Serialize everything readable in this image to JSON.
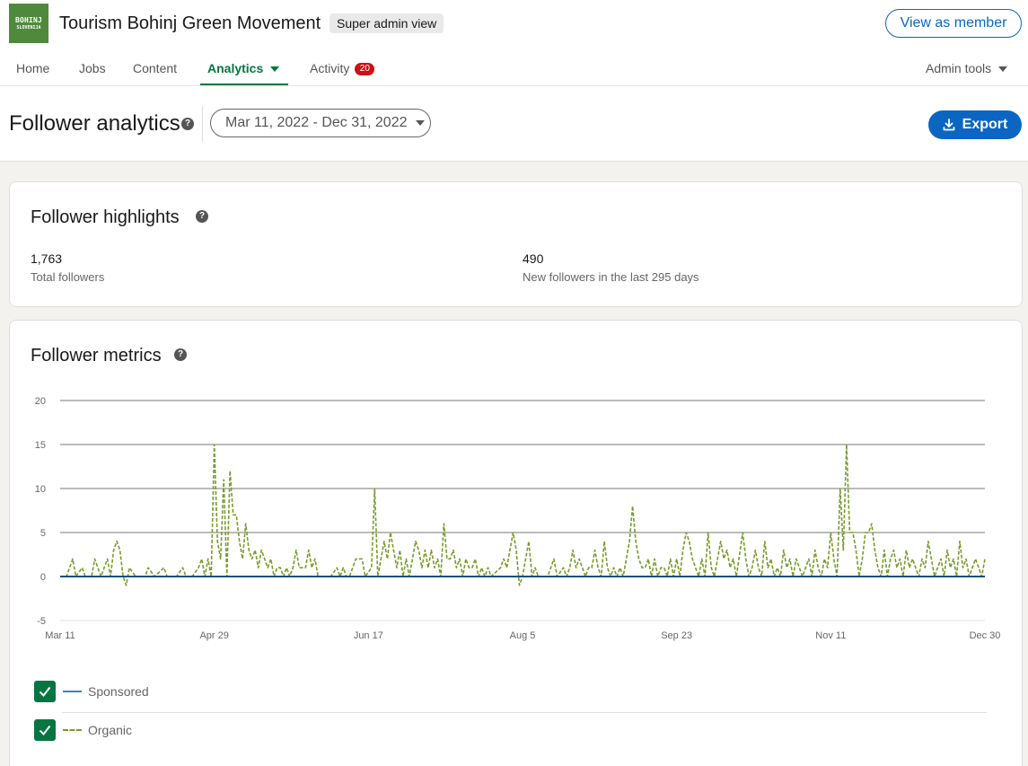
{
  "org": {
    "logo_text": [
      "BOHINJ",
      "SLOVENIJA"
    ],
    "name": "Tourism Bohinj Green Movement",
    "admin_badge": "Super admin view",
    "view_as_member": "View as member"
  },
  "nav": {
    "home": "Home",
    "jobs": "Jobs",
    "content": "Content",
    "analytics": "Analytics",
    "activity": "Activity",
    "activity_count": "20",
    "admin_tools": "Admin tools"
  },
  "page": {
    "title": "Follower analytics",
    "date_range": "Mar 11, 2022 - Dec 31, 2022",
    "export": "Export"
  },
  "highlights": {
    "title": "Follower highlights",
    "total_value": "1,763",
    "total_label": "Total followers",
    "new_value": "490",
    "new_label": "New followers in the last 295 days"
  },
  "metrics": {
    "title": "Follower metrics"
  },
  "legend": {
    "sponsored": "Sponsored",
    "organic": "Organic"
  },
  "colors": {
    "accent_green": "#057642",
    "brand_blue": "#0a66c2",
    "sponsored_line": "#1f4e79",
    "organic_line": "#7a9a2b",
    "badge_red": "#cc1016"
  },
  "chart_data": {
    "type": "line",
    "ylim": [
      -5,
      20
    ],
    "yticks": [
      20,
      15,
      10,
      5,
      0,
      -5
    ],
    "xlim": [
      0,
      294
    ],
    "xticks": [
      {
        "day": 0,
        "label": "Mar 11"
      },
      {
        "day": 49,
        "label": "Apr 29"
      },
      {
        "day": 98,
        "label": "Jun 17"
      },
      {
        "day": 147,
        "label": "Aug 5"
      },
      {
        "day": 196,
        "label": "Sep 23"
      },
      {
        "day": 245,
        "label": "Nov 11"
      },
      {
        "day": 294,
        "label": "Dec 30"
      }
    ],
    "grid": true,
    "series": [
      {
        "name": "Sponsored",
        "style": "solid",
        "points": [
          [
            0,
            0
          ],
          [
            294,
            0
          ]
        ]
      },
      {
        "name": "Organic",
        "style": "dashed",
        "points": [
          [
            0,
            0
          ],
          [
            2,
            0
          ],
          [
            4,
            2
          ],
          [
            5,
            0
          ],
          [
            7,
            1
          ],
          [
            8,
            0
          ],
          [
            10,
            0
          ],
          [
            11,
            2
          ],
          [
            13,
            0
          ],
          [
            15,
            2
          ],
          [
            16,
            0
          ],
          [
            17,
            3
          ],
          [
            18,
            4
          ],
          [
            19,
            3
          ],
          [
            20,
            0
          ],
          [
            21,
            -1
          ],
          [
            22,
            1
          ],
          [
            24,
            0
          ],
          [
            27,
            0
          ],
          [
            28,
            1
          ],
          [
            30,
            0
          ],
          [
            33,
            1
          ],
          [
            34,
            0
          ],
          [
            37,
            0
          ],
          [
            39,
            1
          ],
          [
            40,
            0
          ],
          [
            42,
            0
          ],
          [
            44,
            1
          ],
          [
            45,
            2
          ],
          [
            46,
            0
          ],
          [
            47,
            2
          ],
          [
            48,
            0
          ],
          [
            49,
            15
          ],
          [
            50,
            4
          ],
          [
            51,
            2
          ],
          [
            52,
            11
          ],
          [
            53,
            0
          ],
          [
            54,
            12
          ],
          [
            55,
            7
          ],
          [
            56,
            7
          ],
          [
            57,
            4
          ],
          [
            58,
            2
          ],
          [
            59,
            6
          ],
          [
            60,
            3
          ],
          [
            61,
            2
          ],
          [
            62,
            3
          ],
          [
            63,
            1
          ],
          [
            64,
            3
          ],
          [
            65,
            2
          ],
          [
            66,
            1
          ],
          [
            67,
            2
          ],
          [
            68,
            0
          ],
          [
            69,
            1
          ],
          [
            70,
            1
          ],
          [
            71,
            0
          ],
          [
            72,
            1
          ],
          [
            73,
            0
          ],
          [
            74,
            1
          ],
          [
            75,
            3
          ],
          [
            76,
            1
          ],
          [
            78,
            1
          ],
          [
            79,
            3
          ],
          [
            80,
            1
          ],
          [
            81,
            2
          ],
          [
            82,
            0
          ],
          [
            86,
            0
          ],
          [
            88,
            1
          ],
          [
            89,
            0
          ],
          [
            90,
            1
          ],
          [
            91,
            0
          ],
          [
            92,
            0
          ],
          [
            93,
            1
          ],
          [
            94,
            2
          ],
          [
            96,
            2
          ],
          [
            97,
            0
          ],
          [
            99,
            1
          ],
          [
            100,
            10
          ],
          [
            101,
            0
          ],
          [
            102,
            2
          ],
          [
            103,
            4
          ],
          [
            104,
            2
          ],
          [
            105,
            5
          ],
          [
            106,
            3
          ],
          [
            107,
            1
          ],
          [
            108,
            3
          ],
          [
            109,
            0
          ],
          [
            110,
            2
          ],
          [
            111,
            0
          ],
          [
            112,
            2
          ],
          [
            113,
            4
          ],
          [
            114,
            3
          ],
          [
            115,
            1
          ],
          [
            116,
            3
          ],
          [
            117,
            1
          ],
          [
            118,
            3
          ],
          [
            119,
            1
          ],
          [
            120,
            2
          ],
          [
            121,
            0
          ],
          [
            122,
            6
          ],
          [
            123,
            2
          ],
          [
            124,
            2
          ],
          [
            125,
            3
          ],
          [
            126,
            1
          ],
          [
            127,
            2
          ],
          [
            128,
            0
          ],
          [
            129,
            2
          ],
          [
            130,
            1
          ],
          [
            131,
            1
          ],
          [
            132,
            2
          ],
          [
            133,
            0
          ],
          [
            134,
            1
          ],
          [
            135,
            0
          ],
          [
            136,
            1
          ],
          [
            137,
            0
          ],
          [
            140,
            1
          ],
          [
            141,
            2
          ],
          [
            142,
            1
          ],
          [
            144,
            5
          ],
          [
            145,
            3
          ],
          [
            146,
            -1
          ],
          [
            147,
            0
          ],
          [
            148,
            2
          ],
          [
            149,
            4
          ],
          [
            150,
            0
          ],
          [
            151,
            1
          ],
          [
            152,
            0
          ],
          [
            155,
            0
          ],
          [
            156,
            1
          ],
          [
            157,
            2
          ],
          [
            158,
            0
          ],
          [
            160,
            1
          ],
          [
            161,
            0
          ],
          [
            162,
            1
          ],
          [
            163,
            3
          ],
          [
            164,
            1
          ],
          [
            165,
            2
          ],
          [
            166,
            1
          ],
          [
            167,
            0
          ],
          [
            168,
            1
          ],
          [
            169,
            1
          ],
          [
            170,
            3
          ],
          [
            171,
            1
          ],
          [
            172,
            0
          ],
          [
            173,
            4
          ],
          [
            174,
            1
          ],
          [
            175,
            0
          ],
          [
            176,
            1
          ],
          [
            177,
            0
          ],
          [
            178,
            1
          ],
          [
            179,
            0
          ],
          [
            180,
            2
          ],
          [
            181,
            4
          ],
          [
            182,
            8
          ],
          [
            183,
            4
          ],
          [
            184,
            2
          ],
          [
            185,
            1
          ],
          [
            186,
            1
          ],
          [
            187,
            2
          ],
          [
            188,
            0
          ],
          [
            189,
            2
          ],
          [
            190,
            0
          ],
          [
            191,
            1
          ],
          [
            192,
            1
          ],
          [
            193,
            0
          ],
          [
            194,
            2
          ],
          [
            195,
            0
          ],
          [
            196,
            2
          ],
          [
            197,
            0
          ],
          [
            198,
            3
          ],
          [
            199,
            5
          ],
          [
            200,
            4
          ],
          [
            201,
            2
          ],
          [
            202,
            1
          ],
          [
            203,
            0
          ],
          [
            204,
            2
          ],
          [
            205,
            0
          ],
          [
            206,
            5
          ],
          [
            207,
            1
          ],
          [
            208,
            0
          ],
          [
            209,
            2
          ],
          [
            210,
            4
          ],
          [
            211,
            2
          ],
          [
            212,
            3
          ],
          [
            213,
            1
          ],
          [
            214,
            2
          ],
          [
            215,
            0
          ],
          [
            217,
            5
          ],
          [
            218,
            2
          ],
          [
            219,
            0
          ],
          [
            220,
            1
          ],
          [
            221,
            3
          ],
          [
            222,
            1
          ],
          [
            223,
            0
          ],
          [
            224,
            4
          ],
          [
            225,
            1
          ],
          [
            226,
            2
          ],
          [
            227,
            0
          ],
          [
            228,
            1
          ],
          [
            229,
            0
          ],
          [
            230,
            3
          ],
          [
            231,
            1
          ],
          [
            232,
            2
          ],
          [
            233,
            0
          ],
          [
            234,
            2
          ],
          [
            235,
            1
          ],
          [
            236,
            0
          ],
          [
            237,
            1
          ],
          [
            238,
            2
          ],
          [
            239,
            0
          ],
          [
            240,
            3
          ],
          [
            241,
            1
          ],
          [
            242,
            0
          ],
          [
            243,
            2
          ],
          [
            244,
            1
          ],
          [
            245,
            5
          ],
          [
            246,
            2
          ],
          [
            247,
            0
          ],
          [
            248,
            10
          ],
          [
            249,
            3
          ],
          [
            250,
            15
          ],
          [
            251,
            5
          ],
          [
            252,
            5
          ],
          [
            253,
            3
          ],
          [
            254,
            0
          ],
          [
            255,
            2
          ],
          [
            256,
            5
          ],
          [
            257,
            5
          ],
          [
            258,
            6
          ],
          [
            259,
            3
          ],
          [
            260,
            1
          ],
          [
            261,
            0
          ],
          [
            262,
            3
          ],
          [
            263,
            0
          ],
          [
            264,
            2
          ],
          [
            265,
            3
          ],
          [
            266,
            1
          ],
          [
            267,
            2
          ],
          [
            268,
            0
          ],
          [
            269,
            3
          ],
          [
            270,
            1
          ],
          [
            271,
            2
          ],
          [
            272,
            1
          ],
          [
            273,
            0
          ],
          [
            274,
            2
          ],
          [
            275,
            1
          ],
          [
            276,
            4
          ],
          [
            277,
            2
          ],
          [
            278,
            0
          ],
          [
            279,
            1
          ],
          [
            280,
            2
          ],
          [
            281,
            0
          ],
          [
            282,
            3
          ],
          [
            283,
            1
          ],
          [
            284,
            2
          ],
          [
            285,
            0
          ],
          [
            286,
            4
          ],
          [
            287,
            1
          ],
          [
            288,
            2
          ],
          [
            289,
            0
          ],
          [
            290,
            1
          ],
          [
            291,
            2
          ],
          [
            292,
            1
          ],
          [
            293,
            0
          ],
          [
            294,
            2
          ]
        ]
      }
    ]
  }
}
